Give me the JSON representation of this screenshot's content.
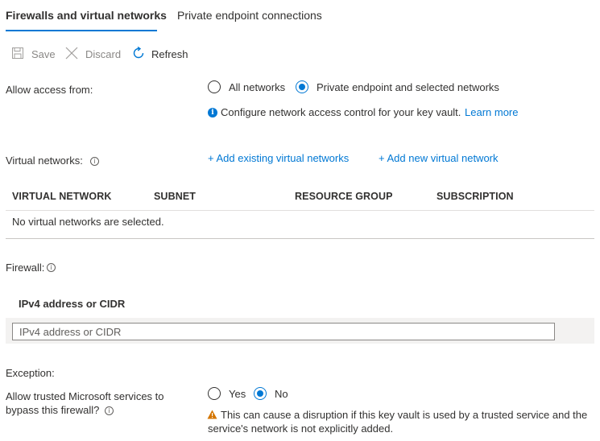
{
  "tabs": [
    {
      "label": "Firewalls and virtual networks",
      "active": true
    },
    {
      "label": "Private endpoint connections",
      "active": false
    }
  ],
  "toolbar": {
    "save_label": "Save",
    "discard_label": "Discard",
    "refresh_label": "Refresh",
    "save_icon": "save-icon",
    "discard_icon": "close-icon",
    "refresh_icon": "refresh-icon"
  },
  "allow_access": {
    "label": "Allow access from:",
    "options": [
      {
        "label": "All networks",
        "selected": false
      },
      {
        "label": "Private endpoint and selected networks",
        "selected": true
      }
    ],
    "info_text": "Configure network access control for your key vault.",
    "learn_more": "Learn more"
  },
  "virtual_networks": {
    "label": "Virtual networks:",
    "add_existing": "+ Add existing virtual networks",
    "add_new": "+ Add new virtual network",
    "columns": [
      "VIRTUAL NETWORK",
      "SUBNET",
      "RESOURCE GROUP",
      "SUBSCRIPTION"
    ],
    "empty_message": "No virtual networks are selected."
  },
  "firewall": {
    "label": "Firewall:",
    "column_header": "IPv4 address or CIDR",
    "input_value": "",
    "input_placeholder": "IPv4 address or CIDR"
  },
  "exception": {
    "label": "Exception:",
    "trusted_label_line1": "Allow trusted Microsoft services to",
    "trusted_label_line2": "bypass this firewall?",
    "options": [
      {
        "label": "Yes",
        "selected": false
      },
      {
        "label": "No",
        "selected": true
      }
    ],
    "warning_line1": "This can cause a disruption if this key vault is used by a trusted service and the",
    "warning_line2": "service's network is not explicitly added."
  },
  "colors": {
    "accent": "#0078d4",
    "warning": "#d47500",
    "text": "#323130",
    "disabled": "#8a8886"
  }
}
